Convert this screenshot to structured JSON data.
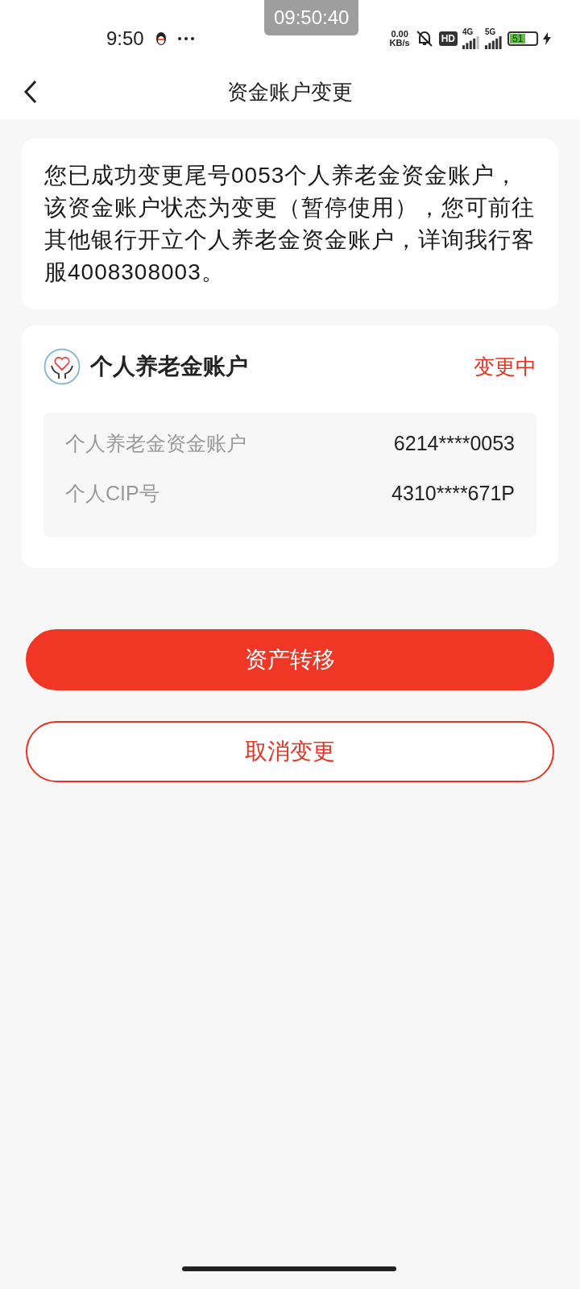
{
  "status_bar": {
    "time": "9:50",
    "overlay_clock": "09:50:40",
    "net_speed": [
      "0.00",
      "KB/s"
    ],
    "hd": "HD",
    "network_1": "4G",
    "network_2": "5G",
    "battery": "51"
  },
  "header": {
    "title": "资金账户变更"
  },
  "notice": "您已成功变更尾号0053个人养老金资金账户，该资金账户状态为变更（暂停使用），您可前往其他银行开立个人养老金资金账户，详询我行客服4008308003。",
  "account_card": {
    "title": "个人养老金账户",
    "status": "变更中",
    "rows": [
      {
        "label": "个人养老金资金账户",
        "value": "6214****0053"
      },
      {
        "label": "个人CIP号",
        "value": "4310****671P"
      }
    ]
  },
  "buttons": [
    {
      "label": "资产转移",
      "kind": "primary"
    },
    {
      "label": "取消变更",
      "kind": "outline"
    }
  ]
}
